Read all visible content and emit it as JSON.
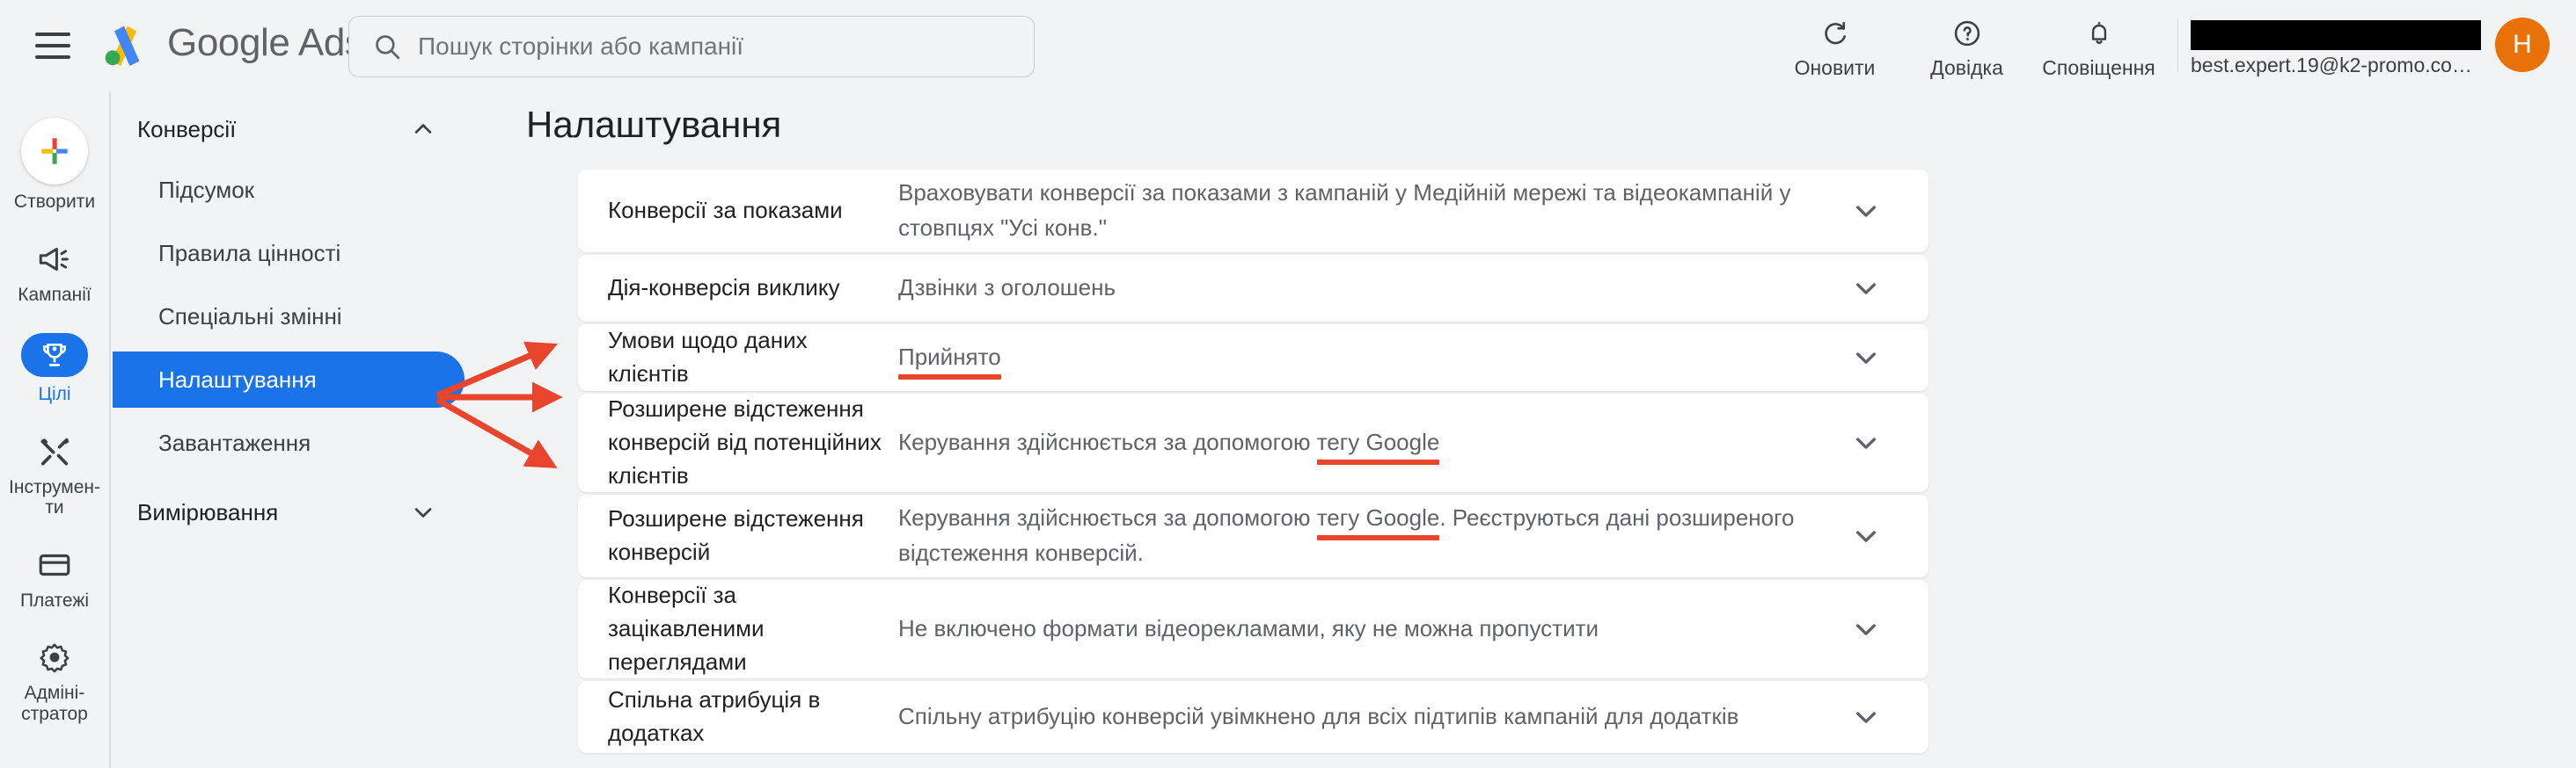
{
  "app": {
    "brand": "Google Ads",
    "page_title": "Налаштування"
  },
  "search": {
    "placeholder": "Пошук сторінки або кампанії",
    "value": "",
    "icon": "search-icon"
  },
  "topbar": {
    "menu_icon": "hamburger-menu-icon",
    "actions": [
      {
        "label": "Оновити",
        "icon": "refresh-icon"
      },
      {
        "label": "Довідка",
        "icon": "help-question-icon"
      },
      {
        "label": "Сповіщення",
        "icon": "bell-notification-icon"
      }
    ],
    "account": {
      "redacted": "",
      "email": "best.expert.19@k2-promo.co…",
      "avatar_initial": "H",
      "avatar_color": "#e8710a"
    }
  },
  "rail": {
    "items": [
      {
        "label": "Створити",
        "icon": "plus-create-icon",
        "active": false,
        "type": "fab"
      },
      {
        "label": "Кампанії",
        "icon": "megaphone-icon",
        "active": false,
        "type": "normal"
      },
      {
        "label": "Цілі",
        "icon": "trophy-goals-icon",
        "active": true,
        "type": "pill"
      },
      {
        "label": "Інструмен-\nти",
        "icon": "tools-wrench-icon",
        "active": false,
        "type": "normal"
      },
      {
        "label": "Платежі",
        "icon": "credit-card-icon",
        "active": false,
        "type": "normal"
      },
      {
        "label": "Адміні-\nстратор",
        "icon": "gear-admin-icon",
        "active": false,
        "type": "normal"
      }
    ]
  },
  "subnav": {
    "groups": [
      {
        "label": "Конверсії",
        "icon": "chevron-up-icon",
        "expanded": true,
        "items": [
          {
            "label": "Підсумок",
            "active": false
          },
          {
            "label": "Правила цінності",
            "active": false
          },
          {
            "label": "Спеціальні змінні",
            "active": false
          },
          {
            "label": "Налаштування",
            "active": true
          },
          {
            "label": "Завантаження",
            "active": false
          }
        ]
      },
      {
        "label": "Вимірювання",
        "icon": "chevron-down-icon",
        "expanded": false,
        "items": []
      }
    ]
  },
  "settings_rows": [
    {
      "label": "Конверсії за показами",
      "value": "Враховувати конверсії за показами з кампаній у Медійній мережі та відеокампаній у стовпцях \"Усі конв.\"",
      "chevron": "chevron-down-icon",
      "highlight": null
    },
    {
      "label": "Дія-конверсія виклику",
      "value": "Дзвінки з оголошень",
      "chevron": "chevron-down-icon",
      "highlight": null
    },
    {
      "label": "Умови щодо даних клієнтів",
      "value": "Прийнято",
      "chevron": "chevron-down-icon",
      "highlight": "Прийнято"
    },
    {
      "label": "Розширене відстеження конверсій від потенційних клієнтів",
      "value": "Керування здійснюється за допомогою тегу Google",
      "chevron": "chevron-down-icon",
      "highlight": "тегу Google"
    },
    {
      "label": "Розширене відстеження конверсій",
      "value": "Керування здійснюється за допомогою тегу Google. Реєструються дані розширеного відстеження конверсій.",
      "chevron": "chevron-down-icon",
      "highlight": "тегу Google"
    },
    {
      "label": "Конверсії за зацікавленими переглядами",
      "value": "Не включено формати відеорекламами, яку не можна пропустити",
      "chevron": "chevron-down-icon",
      "highlight": null
    },
    {
      "label": "Спільна атрибуція в додатках",
      "value": "Спільну атрибуцію конверсій увімкнено для всіх підтипів кампаній для додатків",
      "chevron": "chevron-down-icon",
      "highlight": null
    }
  ],
  "annotations": {
    "color": "#e8452c",
    "arrow_count": 3,
    "underline_count": 3
  },
  "colors": {
    "accent_blue": "#1a73e8",
    "annotation_red": "#e8452c",
    "page_bg": "#f1f3f4",
    "card_bg": "#ffffff",
    "text_primary": "#202124",
    "text_secondary": "#5f6368"
  }
}
